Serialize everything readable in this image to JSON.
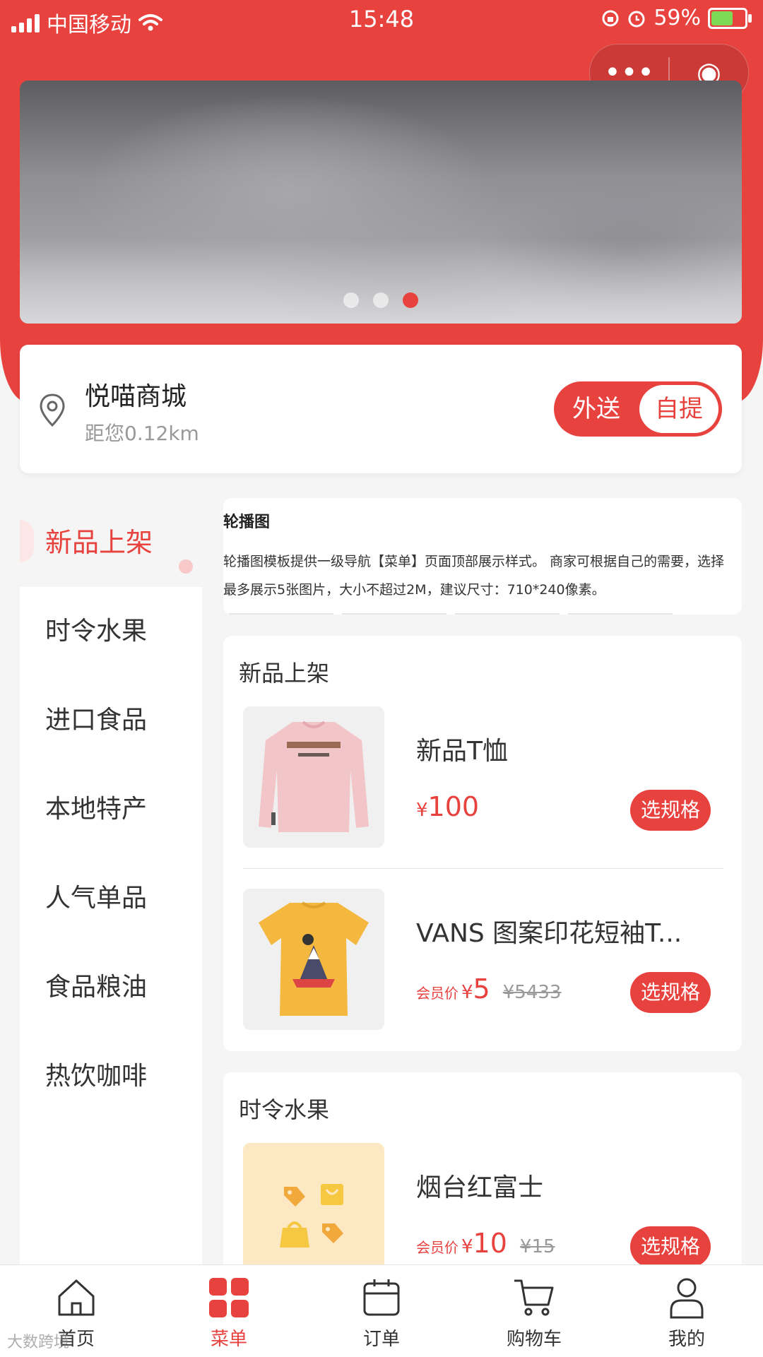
{
  "status_bar": {
    "carrier": "中国移动",
    "time": "15:48",
    "battery": "59%"
  },
  "banner": {
    "slide_count": 3,
    "active_slide": 3
  },
  "store": {
    "name": "悦喵商城",
    "distance": "距您0.12km"
  },
  "delivery_toggle": {
    "option_delivery": "外送",
    "option_pickup": "自提",
    "selected": "自提"
  },
  "sidebar": {
    "items": [
      {
        "label": "新品上架",
        "active": true
      },
      {
        "label": "时令水果"
      },
      {
        "label": "进口食品"
      },
      {
        "label": "本地特产"
      },
      {
        "label": "人气单品"
      },
      {
        "label": "食品粮油"
      },
      {
        "label": "热饮咖啡"
      }
    ]
  },
  "info_card": {
    "title": "轮播图",
    "line1": "轮播图模板提供一级导航【菜单】页面顶部展示样式。 商家可根据自己的需要，选择",
    "line2": "最多展示5张图片，大小不超过2M，建议尺寸：710*240像素。"
  },
  "sections": [
    {
      "title": "新品上架",
      "products": [
        {
          "name": "新品T恤",
          "yen": "¥",
          "price": "100",
          "spec_label": "选规格"
        },
        {
          "name": "VANS 图案印花短袖T...",
          "member_label": "会员价",
          "yen": "¥",
          "price": "5",
          "original_price": "¥5433",
          "spec_label": "选规格"
        }
      ]
    },
    {
      "title": "时令水果",
      "products": [
        {
          "name": "烟台红富士",
          "member_label": "会员价",
          "yen": "¥",
          "price": "10",
          "original_price": "¥15",
          "spec_label": "选规格"
        }
      ]
    }
  ],
  "tabbar": {
    "items": [
      {
        "label": "首页",
        "icon": "home-icon"
      },
      {
        "label": "菜单",
        "icon": "menu-grid-icon",
        "active": true
      },
      {
        "label": "订单",
        "icon": "calendar-icon"
      },
      {
        "label": "购物车",
        "icon": "cart-icon"
      },
      {
        "label": "我的",
        "icon": "user-icon"
      }
    ]
  },
  "watermark": "大数跨境",
  "colors": {
    "accent": "#e8423f",
    "background": "#f5f5f5"
  }
}
